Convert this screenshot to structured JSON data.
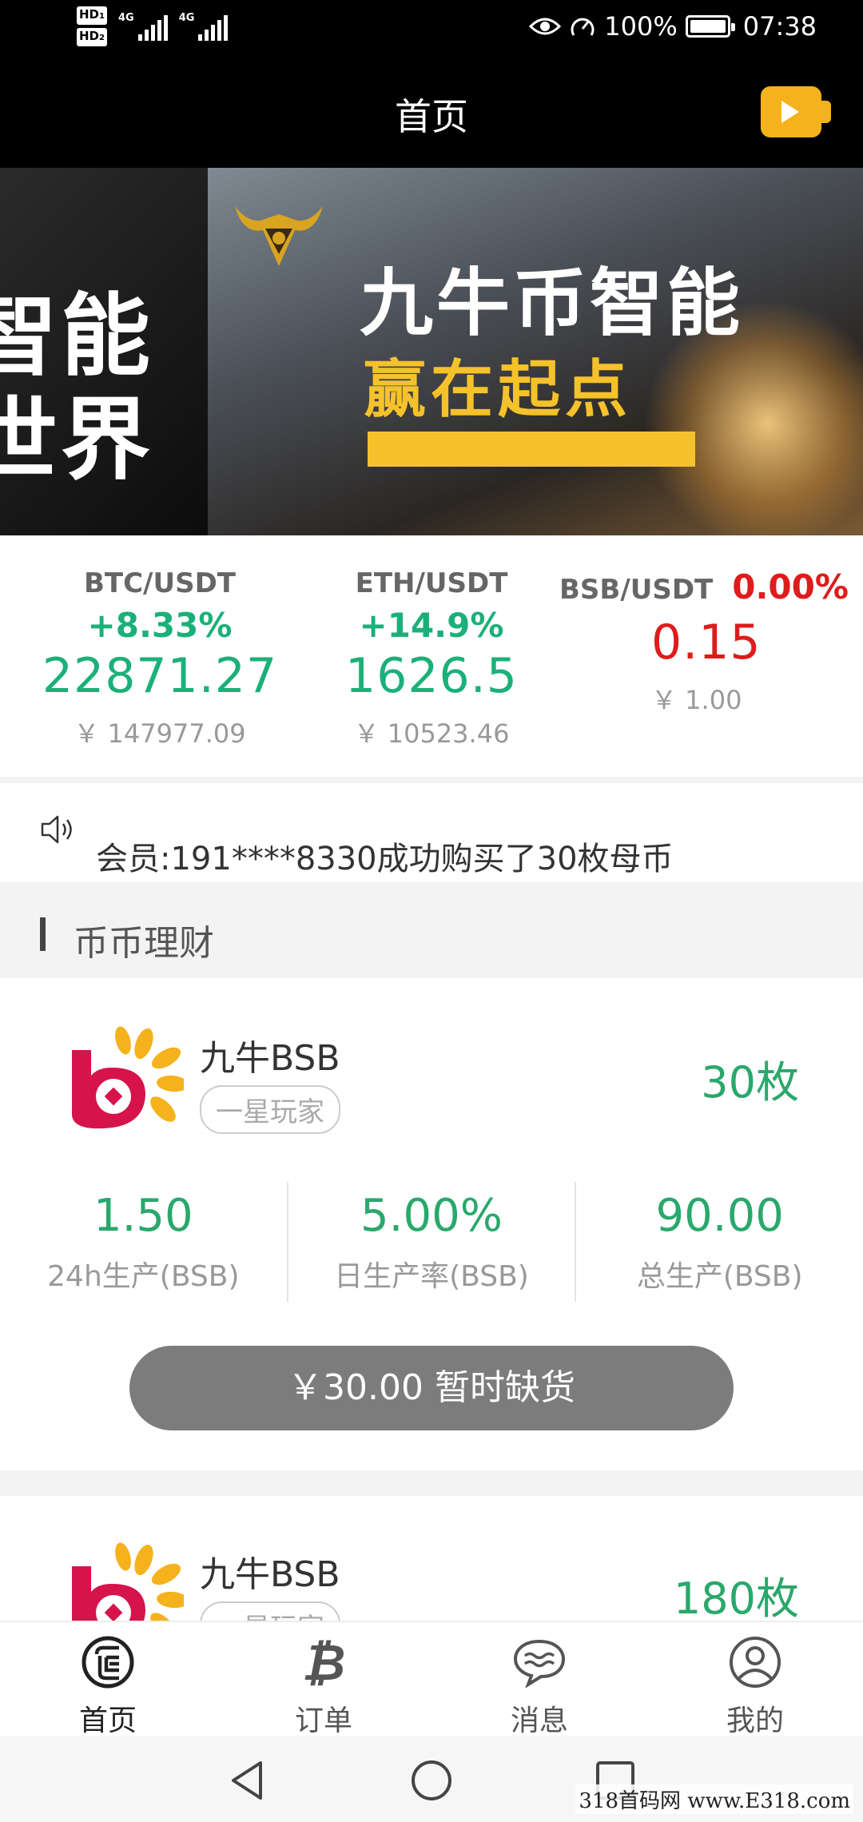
{
  "status_bar": {
    "hd1": "HD",
    "hd1_sub": "1",
    "hd2": "HD",
    "hd2_sub": "2",
    "net1": "4G",
    "net2": "4G",
    "battery": "100%",
    "time": "07:38"
  },
  "header": {
    "title": "首页",
    "video_icon": "video-camera-icon"
  },
  "banner": {
    "left_line1": "智能",
    "left_line2": "世界",
    "headline": "九牛币智能",
    "subline": "赢在起点",
    "slide_count": 6,
    "active_slide": 3
  },
  "tickers": [
    {
      "pair": "BTC/USDT",
      "change": "+8.33%",
      "price": "22871.27",
      "cny": "￥ 147977.09",
      "color": "#1bb07a"
    },
    {
      "pair": "ETH/USDT",
      "change": "+14.9%",
      "price": "1626.5",
      "cny": "￥ 10523.46",
      "color": "#1bb07a"
    },
    {
      "pair": "BSB/USDT",
      "change": "0.00%",
      "price": "0.15",
      "cny": "￥ 1.00",
      "color": "#e01b1b"
    }
  ],
  "notice": {
    "icon": "speaker-icon",
    "text": "会员:191****8330成功购买了30枚母币"
  },
  "section": {
    "title": "币币理财"
  },
  "products": [
    {
      "name": "九牛BSB",
      "level": "一星玩家",
      "quantity": "30枚",
      "stats": [
        {
          "value": "1.50",
          "label": "24h生产(BSB)"
        },
        {
          "value": "5.00%",
          "label": "日生产率(BSB)"
        },
        {
          "value": "90.00",
          "label": "总生产(BSB)"
        }
      ],
      "button": "￥30.00 暂时缺货"
    },
    {
      "name": "九牛BSB",
      "level": "一星玩家",
      "quantity": "180枚"
    }
  ],
  "bottom_nav": [
    {
      "label": "首页",
      "icon": "home-icon",
      "active": true
    },
    {
      "label": "订单",
      "icon": "bitcoin-icon",
      "active": false
    },
    {
      "label": "消息",
      "icon": "chat-icon",
      "active": false
    },
    {
      "label": "我的",
      "icon": "user-icon",
      "active": false
    }
  ],
  "watermark": "318首码网 www.E318.com",
  "colors": {
    "accent": "#f5b21c",
    "up_green": "#1bb07a",
    "product_green": "#2aa86c",
    "down_red": "#e01b1b",
    "button_gray": "#7c7c7c"
  }
}
